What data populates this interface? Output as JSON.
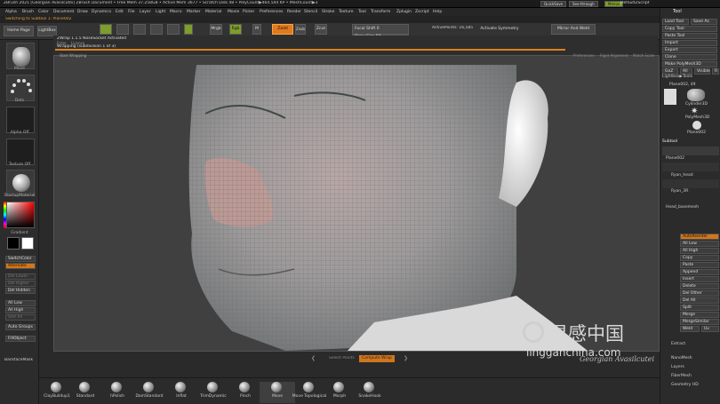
{
  "window": {
    "title": "ZBrush 2021 [Georgian Avasilcutei] ZBrush Document  • Free Mem 37.258GB • Active Mem 3677 • Scratch Disk 48 • PolyCount▶464.544 KP • MeshCount▶3",
    "quicksave": "QuickSave",
    "seethrough": "See-through",
    "menus_label": "Menus",
    "default_zscript": "DefaultZScript"
  },
  "menubar": [
    "Alpha",
    "Brush",
    "Color",
    "Document",
    "Draw",
    "Dynamics",
    "Edit",
    "File",
    "Layer",
    "Light",
    "Macro",
    "Marker",
    "Material",
    "Movie",
    "Picker",
    "Preferences",
    "Render",
    "Stencil",
    "Stroke",
    "Texture",
    "Tool",
    "Transform",
    "Zplugin",
    "Zscript",
    "Help"
  ],
  "subtool_switch": "Switching to Subtool 1:  Plane002",
  "toolbar": {
    "home_page": "Home Page",
    "lightbox": "LightBox",
    "mrgb": "Mrgb",
    "rgb": "Rgb",
    "m": "M",
    "zadd": "Zadd",
    "zsub": "Zsub",
    "zcut": "Zcut",
    "focal_shift": "Focal Shift 0",
    "active_points": "ActivePoints: 16,585",
    "activate_symmetry": "Activate Symmetry",
    "mirror_and_weld": "Mirror And Weld",
    "total_points": "TotalPoints: 2,156 Mil",
    "draw_size": "Draw Size 58",
    "dynamic": "Dynamic",
    "s": "S",
    "z_intensity": "Z Intensity 25"
  },
  "document": {
    "wrap_title": "ZWrap 1.1.5  NoseSocket Activated",
    "line2_a": "Enter",
    "line2_b": "License",
    "progress": "Wrapping (subdivision 1 of 3)",
    "start_wrapping": "Start Wrapping",
    "preferences": "Preferences",
    "rigid_alignment": "Rigid Alignment",
    "match_scale": "Match Scale"
  },
  "bottom_nav": {
    "prev_label": "Select Points",
    "current_label": "Compute Wrap"
  },
  "left_panel": {
    "move": "Move",
    "dots": "Dots",
    "alpha_off": "Alpha Off",
    "texture_off": "Texture Off",
    "material": "StartupMaterial",
    "gradient": "Gradient",
    "switch_color": "SwitchColor",
    "alternate": "Alternate",
    "del_lower": "Del Lower",
    "del_higher": "Del Higher",
    "del_hidden": "Del Hidden",
    "all_low": "All Low",
    "all_high": "All High",
    "smt_all": "Smt All",
    "auto_groups": "Auto Groups",
    "fill_object": "FillObject",
    "backface_mask": "BackfaceMask"
  },
  "right_panel": {
    "tool": "Tool",
    "load_tool": "Load Tool",
    "save_as": "Save As",
    "copy_tool": "Copy Tool",
    "paste_tool": "Paste Tool",
    "import": "Import",
    "export": "Export",
    "clone": "Clone",
    "make_polymesh": "Make PolyMesh3D",
    "goz": "GoZ",
    "all": "All",
    "visible": "Visible",
    "r": "R",
    "lightbox_tools": "Lightbox▶Tools",
    "plane_label": "Plane002, 49",
    "cylinder3d": "Cylinder3D",
    "polymesh3d": "PolyMesh3D",
    "plane002": "Plane002",
    "subtool": "Subtool",
    "plane002_item": "Plane002",
    "ryan_head": "Ryan_head",
    "ryan_3r": "Ryan_3R",
    "head_basemesh": "Head_basemesh",
    "auto_reorder": "AutoReorder",
    "all_low": "All Low",
    "all_high": "All High",
    "copy": "Copy",
    "paste": "Paste",
    "duplicate": "Duplicate",
    "append": "Append",
    "insert": "Insert",
    "delete": "Delete",
    "del_other": "Del Other",
    "del_all": "Del All",
    "split": "Split",
    "merge": "Merge",
    "merge_similar": "MergeSimilar",
    "weld": "Weld",
    "uv": "Uv",
    "extract": "Extract",
    "nanomesh": "NanoMesh",
    "layers": "Layers",
    "fibermesh": "FiberMesh",
    "geometry_hd": "Geometry HD"
  },
  "brushes": [
    {
      "name": "ClayBuildup1"
    },
    {
      "name": "Standard"
    },
    {
      "name": "hPolish"
    },
    {
      "name": "DamStandard"
    },
    {
      "name": "Inflat"
    },
    {
      "name": "TrimDynamic"
    },
    {
      "name": "Pinch"
    },
    {
      "name": "Move"
    },
    {
      "name": "Move Topological"
    },
    {
      "name": "Morph"
    },
    {
      "name": "SnakeHook"
    }
  ],
  "watermark": {
    "brand_cn": "灵感中国",
    "brand_url": "lingganchina.com",
    "author": "Georgian Avasilcutei"
  },
  "colors": {
    "accent_orange": "#e07a1e",
    "active_green": "#7d9e2a",
    "panel_bg": "#2b2b2b",
    "viewport_bg": "#404040",
    "watermark_text": "#c8c8c8"
  }
}
